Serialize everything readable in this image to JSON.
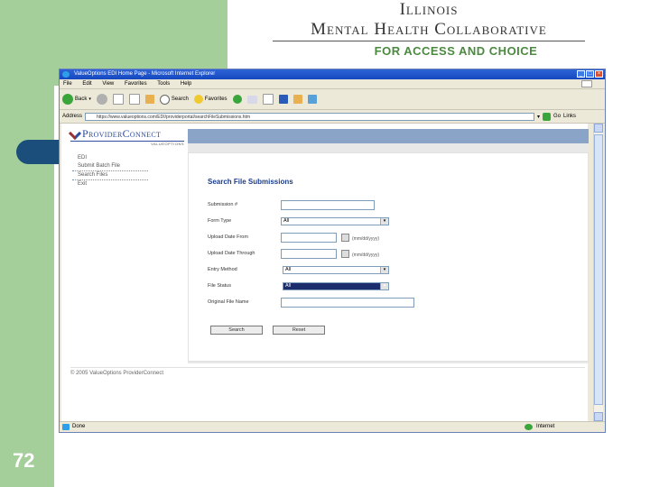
{
  "slide": {
    "number": "72"
  },
  "logo": {
    "line1": "Illinois",
    "line2": "Mental Health Collaborative",
    "line3": "FOR ACCESS AND CHOICE"
  },
  "browser": {
    "title": "ValueOptions EDI Home Page - Microsoft Internet Explorer",
    "menu": [
      "File",
      "Edit",
      "View",
      "Favorites",
      "Tools",
      "Help"
    ],
    "toolbar": {
      "back": "Back",
      "search": "Search",
      "favorites": "Favorites"
    },
    "address_label": "Address",
    "address_value": "https://www.valueoptions.com/EDI/providerportal/searchFileSubmissions.htm",
    "go_label": "Go",
    "links_label": "Links",
    "status_text": "Done",
    "zone_text": "Internet"
  },
  "page": {
    "brand": "ProviderConnect",
    "brand_sub": "VALUEOPTIONS",
    "nav": [
      {
        "label": "EDI"
      },
      {
        "label": "Submit Batch File"
      },
      {
        "label": "Search Files"
      },
      {
        "label": "Exit"
      }
    ],
    "form": {
      "title": "Search File Submissions",
      "fields": {
        "submission_number": {
          "label": "Submission #",
          "value": ""
        },
        "form_type": {
          "label": "Form Type",
          "value": "All"
        },
        "upload_date_from": {
          "label": "Upload Date From",
          "value": "",
          "format": "(mm/dd/yyyy)"
        },
        "upload_date_through": {
          "label": "Upload Date Through",
          "value": "",
          "format": "(mm/dd/yyyy)"
        },
        "entry_method": {
          "label": "Entry Method",
          "value": "All"
        },
        "file_status": {
          "label": "File Status",
          "value": "All"
        },
        "original_file_name": {
          "label": "Original File Name",
          "value": ""
        }
      },
      "buttons": {
        "search": "Search",
        "reset": "Reset"
      }
    },
    "footer": "© 2005 ValueOptions ProviderConnect"
  }
}
